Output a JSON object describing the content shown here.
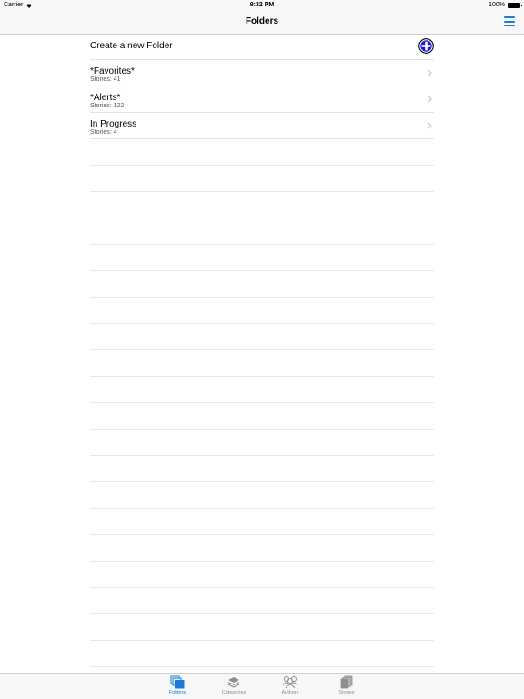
{
  "status_bar": {
    "carrier": "Carrier",
    "time": "9:32 PM",
    "battery": "100%"
  },
  "nav": {
    "title": "Folders",
    "menu_icon": "hamburger-icon"
  },
  "create_row": {
    "label": "Create a new Folder",
    "icon": "add-circle-icon"
  },
  "folders": [
    {
      "name": "*Favorites*",
      "count": "Stories: 41"
    },
    {
      "name": "*Alerts*",
      "count": "Stories: 122"
    },
    {
      "name": "In Progress",
      "count": "Stories: 4"
    }
  ],
  "tabs": [
    {
      "label": "Folders",
      "icon": "folders-icon",
      "active": true
    },
    {
      "label": "Categories",
      "icon": "categories-icon",
      "active": false
    },
    {
      "label": "Authors",
      "icon": "authors-icon",
      "active": false
    },
    {
      "label": "Stories",
      "icon": "stories-icon",
      "active": false
    }
  ],
  "colors": {
    "accent": "#1c7cd5",
    "add_icon": "#1a1adb",
    "bar_background": "#f7f7f7",
    "separator": "#e3e3e3"
  }
}
